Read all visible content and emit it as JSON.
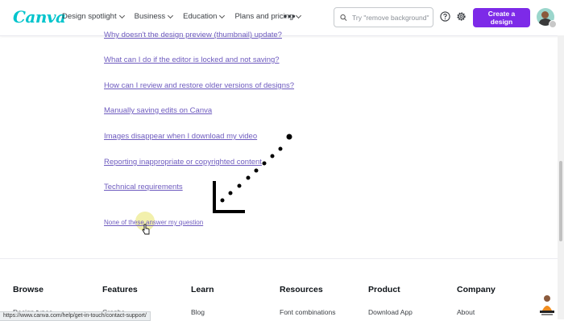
{
  "header": {
    "logo": "Canva",
    "nav": [
      "Design spotlight",
      "Business",
      "Education",
      "Plans and pricing"
    ],
    "more_label": "•••",
    "search_placeholder": "Try \"remove background\" o",
    "create_button": "Create a design"
  },
  "links": [
    "Why doesn't the design preview (thumbnail) update?",
    "What can I do if the editor is locked and not saving?",
    "How can I review and restore older versions of designs?",
    "Manually saving edits on Canva",
    "Images disappear when I download my video",
    "Reporting inappropriate or copyrighted content",
    "Technical requirements"
  ],
  "none_link": "None of these answer my question",
  "footer": {
    "columns": [
      {
        "heading": "Browse",
        "item": "Design types"
      },
      {
        "heading": "Features",
        "item": "Graphs"
      },
      {
        "heading": "Learn",
        "item": "Blog"
      },
      {
        "heading": "Resources",
        "item": "Font combinations"
      },
      {
        "heading": "Product",
        "item": "Download App"
      },
      {
        "heading": "Company",
        "item": "About"
      }
    ]
  },
  "status_url": "https://www.canva.com/help/get-in-touch/contact-support/",
  "colors": {
    "brand": "#7d2ae8",
    "logo": "#00c4cc",
    "link": "#6e5bbf"
  }
}
